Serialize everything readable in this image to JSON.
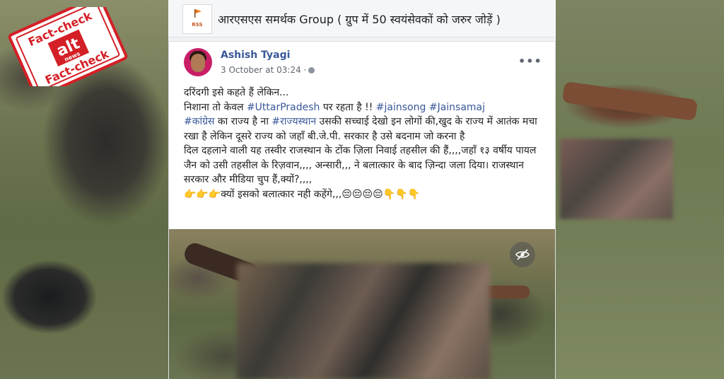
{
  "stamp": {
    "top_text": "Fact-check",
    "bottom_text": "Fact-check",
    "logo_letters": "alt",
    "logo_sub": "news"
  },
  "group": {
    "logo_text": "RSS",
    "title": "आरएसएस समर्थक Group ( ग्रुप में 50 स्वयंसेवकों को जरुर जोड़ें )"
  },
  "post": {
    "author": "Ashish Tyagi",
    "timestamp": "3 October at 03:24 ·",
    "more_icon": "more-options-icon",
    "lines": {
      "l1": "दरिंदगी इसे कहते हैं लेकिन...",
      "l2a": "निशाना तो केवल ",
      "l2_tag1": "#UttarPradesh",
      "l2b": "  पर रहता है !! ",
      "l2_tag2": "#jainsong",
      "l2_tag3": "#Jainsamaj",
      "l3_tag1": "#कांग्रेस",
      "l3a": " का राज्य है ना ",
      "l3_tag2": "#राज्यस्थान",
      "l3b": " उसकी सच्चाई देखो इन लोगों की,खुद के राज्य में आतंक मचा रखा है लेकिन दूसरे राज्य को जहाँ बी.जे.पी. सरकार है उसे बदनाम जो करना है",
      "l4": "दिल दहलाने वाली यह तस्वीर राजस्थान के टोंक ज़िला निवाई तहसील की हैं,,,,जहाँ १३ वर्षीय पायल जैन को उसी तहसील के रिज़वान,,,, अन्सारी,,, ने बलात्कार के बाद ज़िन्दा जला दिया। राजस्थान सरकार और मीडिया चुप हैं,क्यों?,,,,",
      "l5": "👉👉👉क्यों इसको बलात्कार नही कहेंगे,,,😔😔😔😔👇👇👇"
    }
  },
  "colors": {
    "link": "#385898",
    "stamp_red": "#d41f26",
    "rss_orange": "#c8531e"
  }
}
